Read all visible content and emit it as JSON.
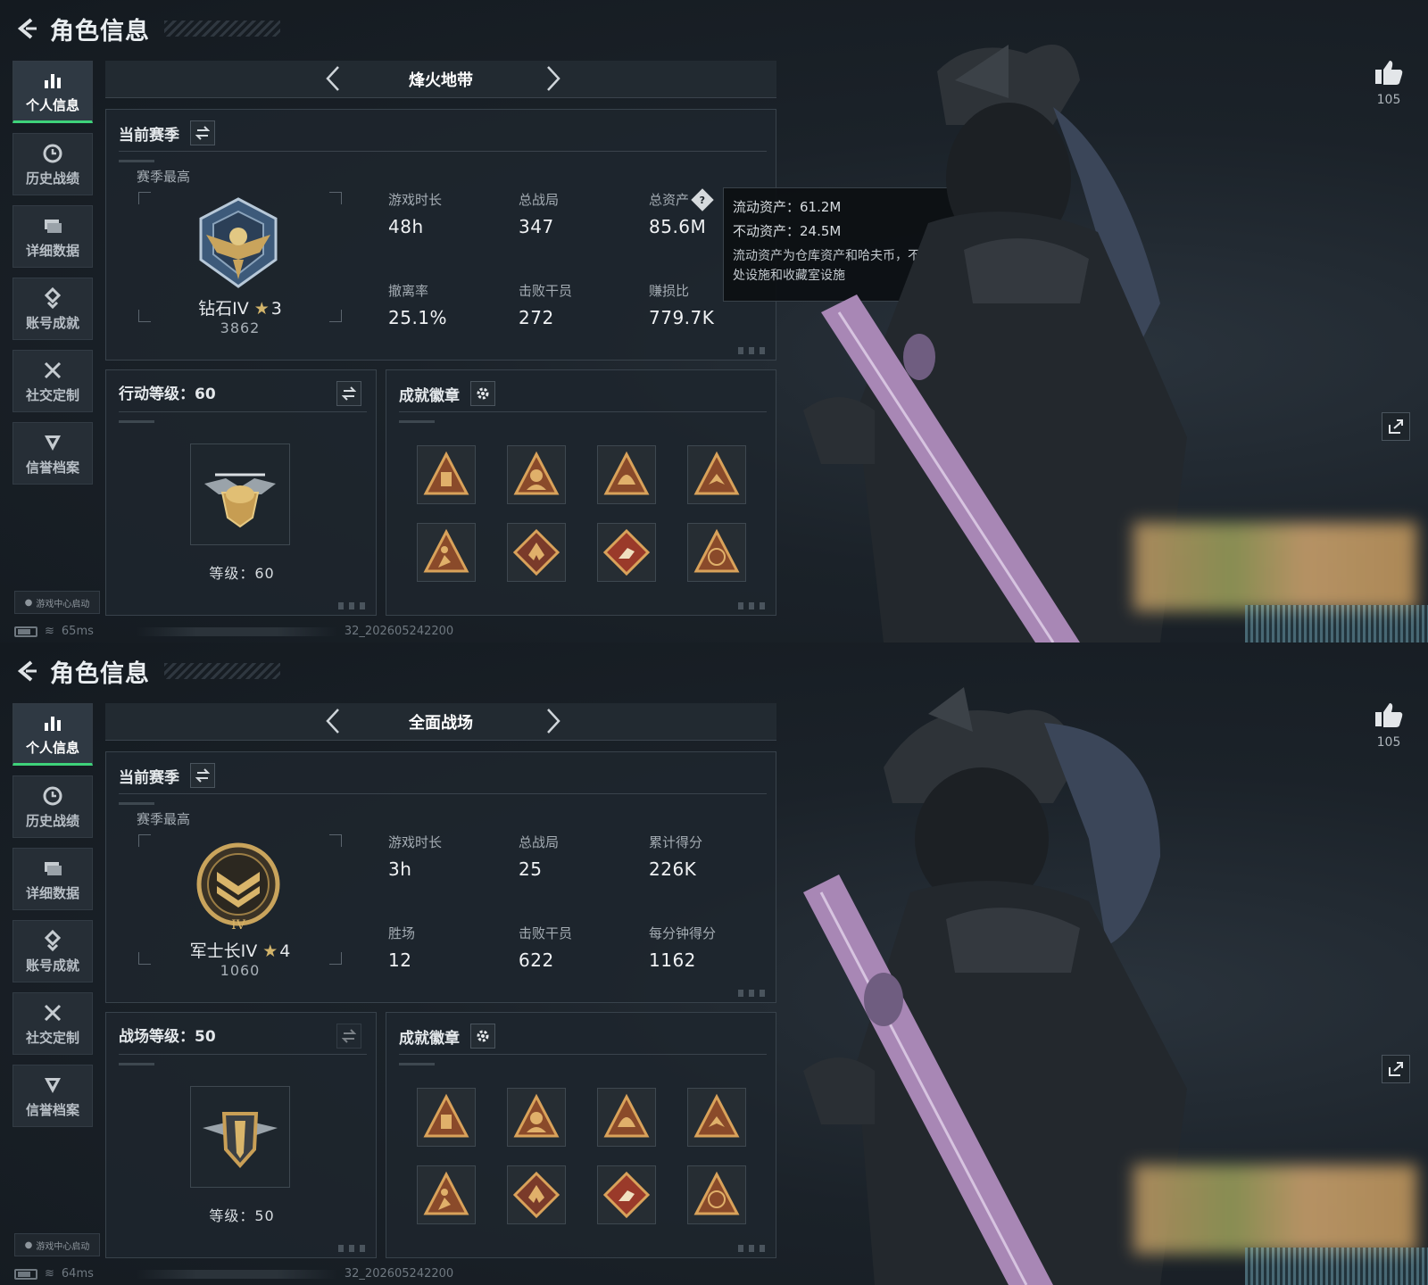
{
  "header": {
    "title": "角色信息"
  },
  "sidebar": {
    "items": [
      {
        "label": "个人信息",
        "icon": "bar-chart-icon"
      },
      {
        "label": "历史战绩",
        "icon": "history-icon"
      },
      {
        "label": "详细数据",
        "icon": "folder-icon"
      },
      {
        "label": "账号成就",
        "icon": "achievement-icon"
      },
      {
        "label": "社交定制",
        "icon": "tools-icon"
      },
      {
        "label": "信誉档案",
        "icon": "credit-icon"
      }
    ]
  },
  "launch_badge": "游戏中心启动",
  "common": {
    "current_season": "当前赛季",
    "season_best": "赛季最高",
    "badges_title": "成就徽章",
    "likes": "105",
    "version": "32_202605242200"
  },
  "screens": [
    {
      "mode": "烽火地带",
      "ping": "65ms",
      "rank": {
        "name": "钻石IV",
        "stars": "3",
        "score": "3862"
      },
      "stats": [
        {
          "label": "游戏时长",
          "value": "48h"
        },
        {
          "label": "总战局",
          "value": "347"
        },
        {
          "label": "总资产",
          "value": "85.6M"
        },
        {
          "label": "撤离率",
          "value": "25.1%"
        },
        {
          "label": "击败干员",
          "value": "272"
        },
        {
          "label": "赚损比",
          "value": "779.7K"
        }
      ],
      "level": {
        "title": "行动等级：60",
        "text": "等级：60"
      },
      "tooltip": {
        "line1": "流动资产：61.2M",
        "line2": "不动资产：24.5M",
        "note": "流动资产为仓库资产和哈夫币，不动资产为特勤处设施和收藏室设施"
      }
    },
    {
      "mode": "全面战场",
      "ping": "64ms",
      "rank": {
        "name": "军士长IV",
        "stars": "4",
        "score": "1060"
      },
      "stats": [
        {
          "label": "游戏时长",
          "value": "3h"
        },
        {
          "label": "总战局",
          "value": "25"
        },
        {
          "label": "累计得分",
          "value": "226K"
        },
        {
          "label": "胜场",
          "value": "12"
        },
        {
          "label": "击败干员",
          "value": "622"
        },
        {
          "label": "每分钟得分",
          "value": "1162"
        }
      ],
      "level": {
        "title": "战场等级：50",
        "text": "等级：50"
      }
    }
  ]
}
